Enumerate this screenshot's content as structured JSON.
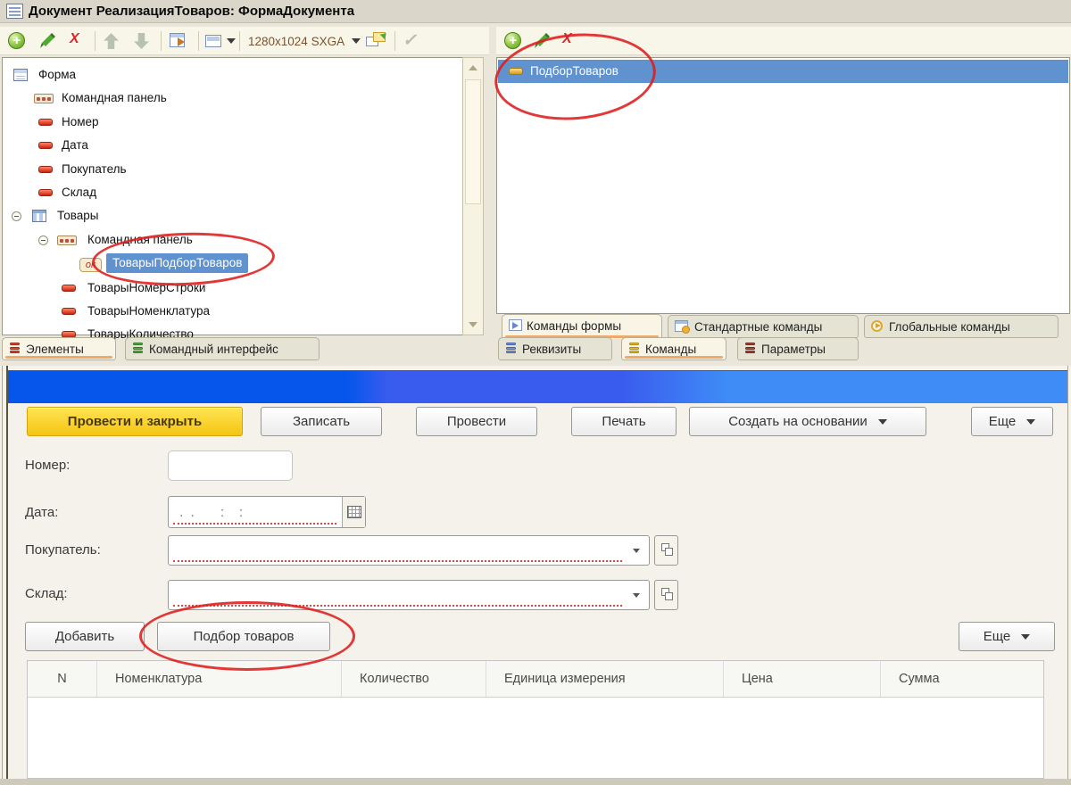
{
  "window": {
    "title": "Документ РеализацияТоваров: ФормаДокумента"
  },
  "icons": {
    "add_glyph": "+",
    "delete_glyph": "X",
    "check_glyph": "✓"
  },
  "left_panel": {
    "toolbar": {
      "resolution_label": "1280x1024 SXGA"
    },
    "tree": {
      "items": [
        {
          "label": "Форма"
        },
        {
          "label": "Командная панель"
        },
        {
          "label": "Номер"
        },
        {
          "label": "Дата"
        },
        {
          "label": "Покупатель"
        },
        {
          "label": "Склад"
        },
        {
          "label": "Товары"
        },
        {
          "label": "Командная панель"
        },
        {
          "label": "ТоварыПодборТоваров",
          "badge": "ок"
        },
        {
          "label": "ТоварыНомерСтроки"
        },
        {
          "label": "ТоварыНоменклатура"
        },
        {
          "label": "ТоварыКоличество"
        }
      ]
    },
    "tabs": {
      "elements": "Элементы",
      "command_interface": "Командный интерфейс"
    }
  },
  "right_panel": {
    "commands_list": {
      "items": [
        {
          "label": "ПодборТоваров"
        }
      ]
    },
    "inner_tabs": {
      "form_commands": "Команды формы",
      "standard_commands": "Стандартные команды",
      "global_commands": "Глобальные команды"
    },
    "outer_tabs": {
      "attributes": "Реквизиты",
      "commands": "Команды",
      "parameters": "Параметры"
    }
  },
  "form_preview": {
    "toolbar": {
      "post_and_close": "Провести и закрыть",
      "save": "Записать",
      "post": "Провести",
      "print": "Печать",
      "create_based_on": "Создать на основании",
      "more": "Еще"
    },
    "fields": {
      "number_label": "Номер:",
      "date_label": "Дата:",
      "date_placeholder": " .  .       :    :",
      "buyer_label": "Покупатель:",
      "warehouse_label": "Склад:"
    },
    "items_toolbar": {
      "add": "Добавить",
      "pick": "Подбор товаров",
      "more": "Еще"
    },
    "items_table": {
      "columns": [
        "N",
        "Номенклатура",
        "Количество",
        "Единица измерения",
        "Цена",
        "Сумма"
      ]
    }
  },
  "colors": {
    "selection_blue": "#5f92cf",
    "annotation_red": "#de1c1c",
    "primary_button_yellow": "#f5c513",
    "active_tab_underline": "#f2a868"
  }
}
